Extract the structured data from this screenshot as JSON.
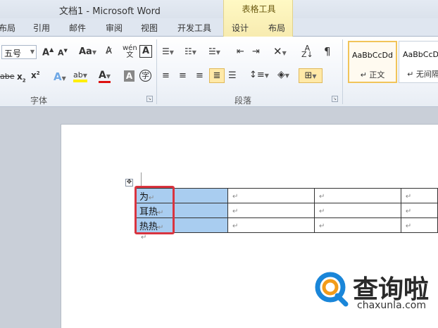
{
  "window": {
    "title": "文档1 - Microsoft Word"
  },
  "context_group": {
    "label": "表格工具"
  },
  "tabs": [
    {
      "label": "布局"
    },
    {
      "label": "引用"
    },
    {
      "label": "邮件"
    },
    {
      "label": "审阅"
    },
    {
      "label": "视图"
    },
    {
      "label": "开发工具"
    },
    {
      "label": "设计"
    },
    {
      "label": "布局"
    }
  ],
  "ribbon": {
    "font_size_value": "五号",
    "change_case_label": "Aa",
    "groups": {
      "font": "字体",
      "paragraph": "段落"
    },
    "styles": [
      {
        "sample": "AaBbCcDd",
        "name": "↵ 正文"
      },
      {
        "sample": "AaBbCcDd",
        "name": "↵ 无间隔"
      }
    ]
  },
  "document": {
    "table": {
      "rows": [
        {
          "cells": [
            "为",
            "",
            "",
            ""
          ]
        },
        {
          "cells": [
            "耳热",
            "",
            "",
            ""
          ]
        },
        {
          "cells": [
            "热热",
            "",
            "",
            ""
          ]
        }
      ]
    },
    "paragraph_mark": "↵",
    "move_handle": "✥"
  },
  "watermark": {
    "brand": "查询啦",
    "url": "chaxunla.com"
  },
  "colors": {
    "selection": "#a9cdf0",
    "highlight_box": "#d9343f",
    "context_tab_bg": "#fff9c4",
    "brand_blue": "#1a86d9",
    "brand_orange": "#f39c1a"
  }
}
